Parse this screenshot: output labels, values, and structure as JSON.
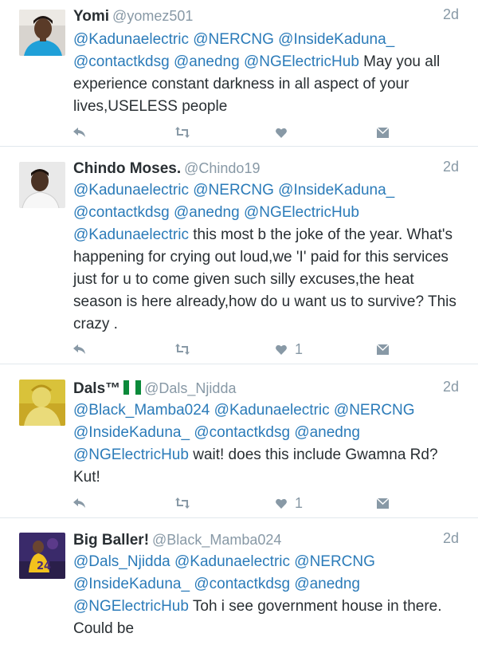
{
  "tweets": [
    {
      "name": "Yomi",
      "handle": "@yomez501",
      "time": "2d",
      "flag": false,
      "text_parts": [
        {
          "t": "@Kadunaelectric",
          "m": true
        },
        {
          "t": " ",
          "m": false
        },
        {
          "t": "@NERCNG",
          "m": true
        },
        {
          "t": " ",
          "m": false
        },
        {
          "t": "@InsideKaduna_",
          "m": true
        },
        {
          "t": " ",
          "m": false
        },
        {
          "t": "@contactkdsg",
          "m": true
        },
        {
          "t": " ",
          "m": false
        },
        {
          "t": "@anedng",
          "m": true
        },
        {
          "t": " ",
          "m": false
        },
        {
          "t": "@NGElectricHub",
          "m": true
        },
        {
          "t": " May you all experience constant darkness in all aspect of your lives,USELESS people",
          "m": false
        }
      ],
      "like_count": ""
    },
    {
      "name": "Chindo Moses.",
      "handle": "@Chindo19",
      "time": "2d",
      "flag": false,
      "text_parts": [
        {
          "t": "@Kadunaelectric",
          "m": true
        },
        {
          "t": " ",
          "m": false
        },
        {
          "t": "@NERCNG",
          "m": true
        },
        {
          "t": " ",
          "m": false
        },
        {
          "t": "@InsideKaduna_",
          "m": true
        },
        {
          "t": " ",
          "m": false
        },
        {
          "t": "@contactkdsg",
          "m": true
        },
        {
          "t": " ",
          "m": false
        },
        {
          "t": "@anedng",
          "m": true
        },
        {
          "t": " ",
          "m": false
        },
        {
          "t": "@NGElectricHub",
          "m": true
        },
        {
          "t": " ",
          "m": false
        },
        {
          "t": "@Kadunaelectric",
          "m": true
        },
        {
          "t": " this most b the joke of the year. What's happening for crying out loud,we 'I' paid for this services just for u to come given such silly excuses,the heat season is here already,how do u want us to survive? This crazy .",
          "m": false
        }
      ],
      "like_count": "1"
    },
    {
      "name": "Dals™",
      "handle": "@Dals_Njidda",
      "time": "2d",
      "flag": true,
      "text_parts": [
        {
          "t": "@Black_Mamba024",
          "m": true
        },
        {
          "t": " ",
          "m": false
        },
        {
          "t": "@Kadunaelectric",
          "m": true
        },
        {
          "t": " ",
          "m": false
        },
        {
          "t": "@NERCNG",
          "m": true
        },
        {
          "t": " ",
          "m": false
        },
        {
          "t": "@InsideKaduna_",
          "m": true
        },
        {
          "t": " ",
          "m": false
        },
        {
          "t": "@contactkdsg",
          "m": true
        },
        {
          "t": " ",
          "m": false
        },
        {
          "t": "@anedng",
          "m": true
        },
        {
          "t": " ",
          "m": false
        },
        {
          "t": "@NGElectricHub",
          "m": true
        },
        {
          "t": " wait! does this include Gwamna Rd? Kut!",
          "m": false
        }
      ],
      "like_count": "1"
    },
    {
      "name": "Big Baller!",
      "handle": "@Black_Mamba024",
      "time": "2d",
      "flag": false,
      "text_parts": [
        {
          "t": "@Dals_Njidda",
          "m": true
        },
        {
          "t": " ",
          "m": false
        },
        {
          "t": "@Kadunaelectric",
          "m": true
        },
        {
          "t": " ",
          "m": false
        },
        {
          "t": "@NERCNG",
          "m": true
        },
        {
          "t": " ",
          "m": false
        },
        {
          "t": "@InsideKaduna_",
          "m": true
        },
        {
          "t": " ",
          "m": false
        },
        {
          "t": "@contactkdsg",
          "m": true
        },
        {
          "t": " ",
          "m": false
        },
        {
          "t": "@anedng",
          "m": true
        },
        {
          "t": " ",
          "m": false
        },
        {
          "t": "@NGElectricHub",
          "m": true
        },
        {
          "t": " Toh i see government house in there. Could be",
          "m": false
        }
      ],
      "like_count": ""
    }
  ],
  "colors": {
    "mention": "#2b7bb9",
    "muted": "#8899a6",
    "text": "#292f33",
    "divider": "#e1e8ed"
  },
  "icons": [
    "reply-icon",
    "retweet-icon",
    "like-icon",
    "message-icon"
  ]
}
